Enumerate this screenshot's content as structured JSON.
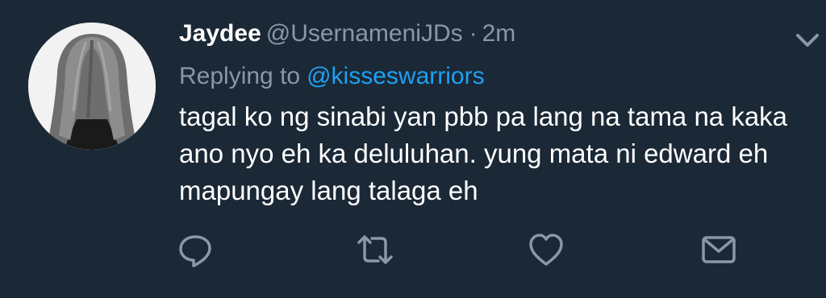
{
  "tweet": {
    "author": {
      "display_name": "Jaydee",
      "handle": "@UsernameniJDs",
      "avatar_icon": "avatar-long-hair-photo"
    },
    "separator": "·",
    "timestamp": "2m",
    "reply": {
      "prefix": "Replying to",
      "mention": "@kisseswarriors"
    },
    "text_lines": [
      "tagal ko ng sinabi yan pbb pa lang na tama na kaka",
      "ano nyo eh ka deluluhan. yung mata ni edward eh",
      "mapungay lang talaga eh"
    ],
    "actions": [
      {
        "name": "reply",
        "icon": "speech-bubble-icon"
      },
      {
        "name": "retweet",
        "icon": "retweet-arrows-icon"
      },
      {
        "name": "like",
        "icon": "heart-icon"
      },
      {
        "name": "direct-message",
        "icon": "envelope-icon"
      }
    ],
    "menu_icon": "chevron-down-icon"
  },
  "colors": {
    "background": "#1b2836",
    "primary_text": "#ffffff",
    "secondary_text": "#8899a6",
    "link": "#1da1f2"
  }
}
